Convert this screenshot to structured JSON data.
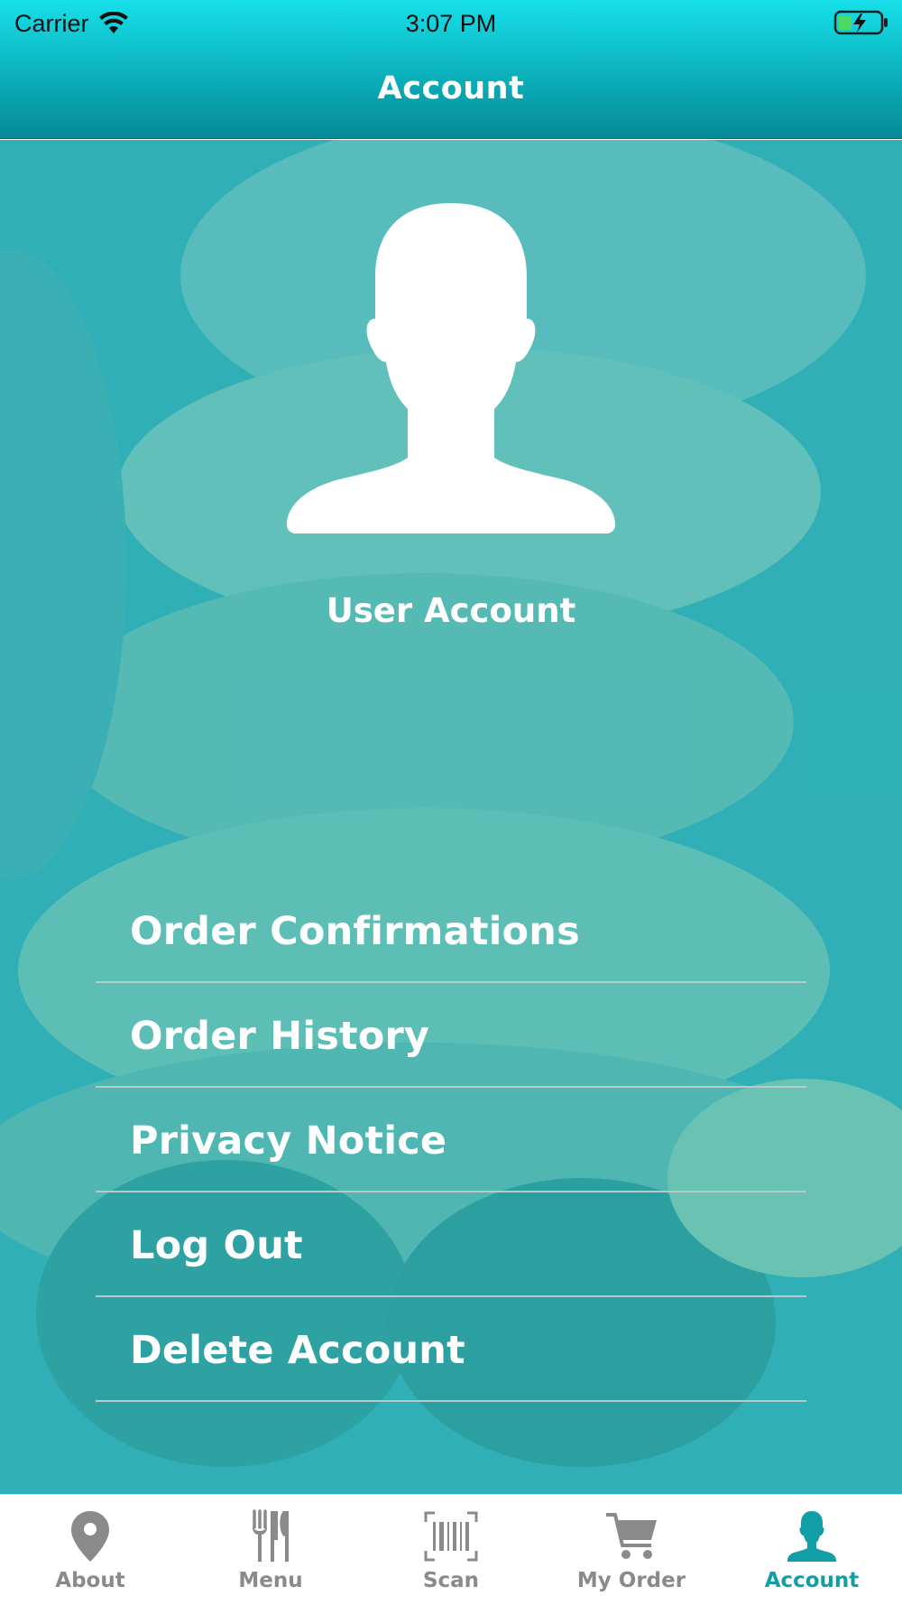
{
  "status_bar": {
    "carrier": "Carrier",
    "time": "3:07 PM"
  },
  "header": {
    "title": "Account"
  },
  "profile": {
    "label": "User Account",
    "avatar_icon": "person-silhouette-icon"
  },
  "menu": {
    "items": [
      {
        "label": "Order Confirmations"
      },
      {
        "label": "Order History"
      },
      {
        "label": "Privacy Notice"
      },
      {
        "label": "Log Out"
      },
      {
        "label": "Delete Account"
      }
    ]
  },
  "tabbar": {
    "tabs": [
      {
        "label": "About",
        "icon": "location-pin-icon",
        "active": false
      },
      {
        "label": "Menu",
        "icon": "fork-knife-icon",
        "active": false
      },
      {
        "label": "Scan",
        "icon": "barcode-icon",
        "active": false
      },
      {
        "label": "My Order",
        "icon": "cart-icon",
        "active": false
      },
      {
        "label": "Account",
        "icon": "person-icon",
        "active": true
      }
    ]
  },
  "colors": {
    "header_top": "#17e0ea",
    "header_bottom": "#058a96",
    "tint": "#3fb4b9",
    "active_tab": "#119ea6",
    "inactive_tab": "#8a8a8a",
    "battery_charge": "#4cd964"
  }
}
